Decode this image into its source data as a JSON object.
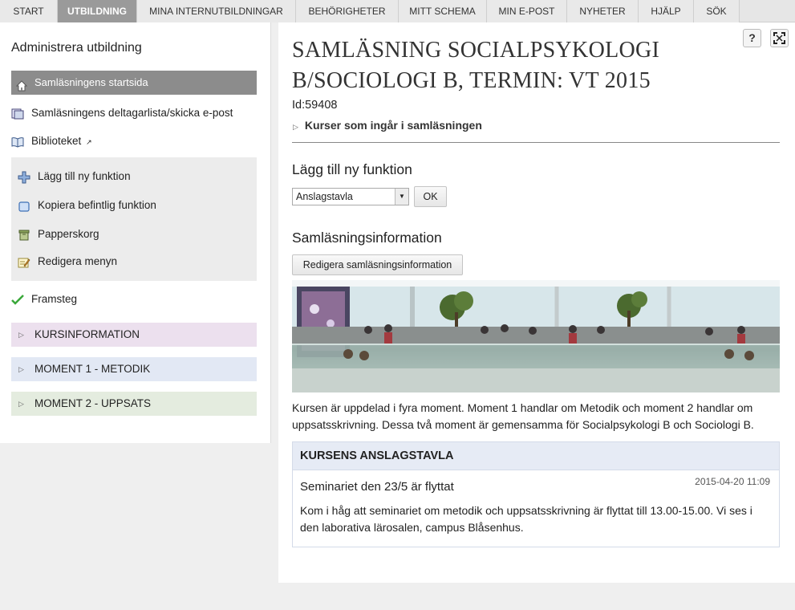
{
  "nav": {
    "tabs": [
      "START",
      "UTBILDNING",
      "MINA INTERNUTBILDNINGAR",
      "BEHÖRIGHETER",
      "MITT SCHEMA",
      "MIN E-POST",
      "NYHETER",
      "HJÄLP",
      "SÖK"
    ],
    "active": "UTBILDNING"
  },
  "sidebar": {
    "title": "Administrera utbildning",
    "selected": "Samläsningens startsida",
    "links": [
      {
        "label": "Samläsningens deltagarlista/skicka e-post",
        "icon": "participants-icon"
      },
      {
        "label": "Biblioteket",
        "icon": "book-icon",
        "external_marker": "↗"
      }
    ],
    "tools": [
      {
        "label": "Lägg till ny funktion",
        "icon": "plus-icon"
      },
      {
        "label": "Kopiera befintlig funktion",
        "icon": "copy-icon"
      },
      {
        "label": "Papperskorg",
        "icon": "trash-icon"
      },
      {
        "label": "Redigera menyn",
        "icon": "edit-menu-icon"
      }
    ],
    "progress": "Framsteg",
    "sections": [
      {
        "label": "KURSINFORMATION",
        "color": "#ece0ee"
      },
      {
        "label": "MOMENT 1 - METODIK",
        "color": "#e2e8f4"
      },
      {
        "label": "MOMENT 2 - UPPSATS",
        "color": "#e4ecdf"
      }
    ]
  },
  "main": {
    "help_button": "?",
    "fullscreen_icon": "expand-icon",
    "title": "SAMLÄSNING SOCIALPSYKOLOGI B/SOCIOLOGI B, TERMIN: VT 2015",
    "id_text": "Id:59408",
    "courses_link": "Kurser som ingår i samläsningen",
    "add_function": {
      "heading": "Lägg till ny funktion",
      "select_value": "Anslagstavla",
      "ok_label": "OK"
    },
    "info": {
      "heading": "Samläsningsinformation",
      "edit_button": "Redigera samläsningsinformation",
      "description": "Kursen är uppdelad i fyra moment. Moment 1 handlar om Metodik och moment 2 handlar om uppsatsskrivning. Dessa två moment är gemensamma för Socialpsykologi B och Sociologi B."
    },
    "board": {
      "heading": "KURSENS ANSLAGSTAVLA",
      "post_title": "Seminariet den 23/5 är flyttat",
      "post_date": "2015-04-20 11:09",
      "post_body": "Kom i håg att seminariet om metodik och uppsatsskrivning är flyttat till 13.00-15.00. Vi ses i den laborativa lärosalen, campus Blåsenhus."
    }
  },
  "colors": {
    "active_tab": "#9a9a9a",
    "selected_item": "#8c8c8c",
    "board_header": "#e6ebf5"
  }
}
